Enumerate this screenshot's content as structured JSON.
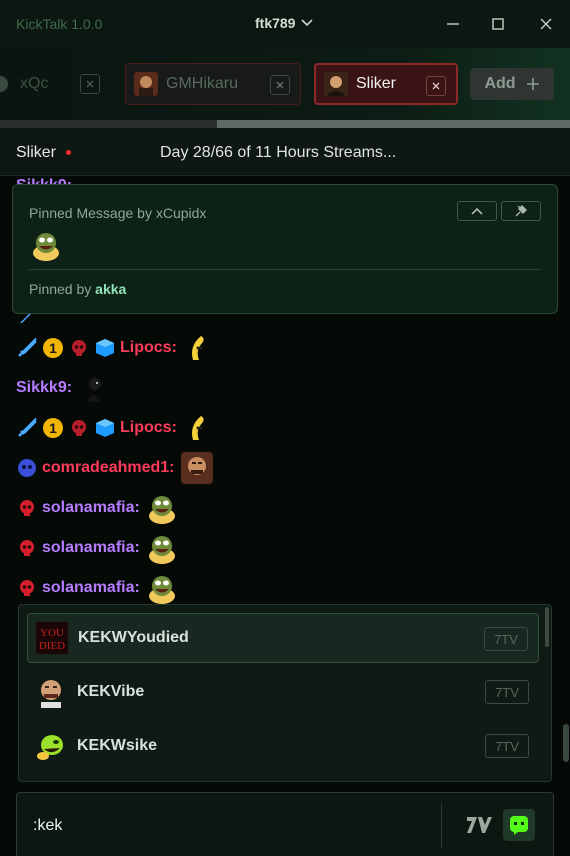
{
  "app": {
    "title": "KickTalk 1.0.0",
    "username": "ftk789"
  },
  "tabs": [
    {
      "label": "xQc"
    },
    {
      "label": "GMHikaru"
    },
    {
      "label": "Sliker",
      "active": true
    }
  ],
  "add_label": "Add",
  "channel": {
    "name": "Sliker",
    "stream_title": "Day 28/66 of 11 Hours Streams..."
  },
  "pinned": {
    "header": "Pinned Message by xCupidx",
    "footer_prefix": "Pinned by",
    "footer_user": "akka"
  },
  "messages": [
    {
      "user": "Lipocs:",
      "color": "#ff3b5c"
    },
    {
      "user": "Sikkk9:",
      "color": "#b67cff"
    },
    {
      "user": "Lipocs:",
      "color": "#ff3b5c"
    },
    {
      "user": "comradeahmed1:",
      "color": "#ff3b5c"
    },
    {
      "user": "solanamafia:",
      "color": "#b67cff"
    },
    {
      "user": "solanamafia:",
      "color": "#b67cff"
    },
    {
      "user": "solanamafia:",
      "color": "#b67cff"
    }
  ],
  "suggestions": [
    {
      "name": "KEKWYoudied",
      "source": "7TV",
      "icon": "youdied-emote"
    },
    {
      "name": "KEKVibe",
      "source": "7TV",
      "icon": "kekvibe-emote"
    },
    {
      "name": "KEKWsike",
      "source": "7TV",
      "icon": "kekwsike-emote"
    }
  ],
  "input": {
    "value": ":kek"
  },
  "colors": {
    "accent": "#53fc18",
    "live": "#ff2a2a",
    "username_red": "#ff3b5c",
    "username_purple": "#b67cff"
  }
}
